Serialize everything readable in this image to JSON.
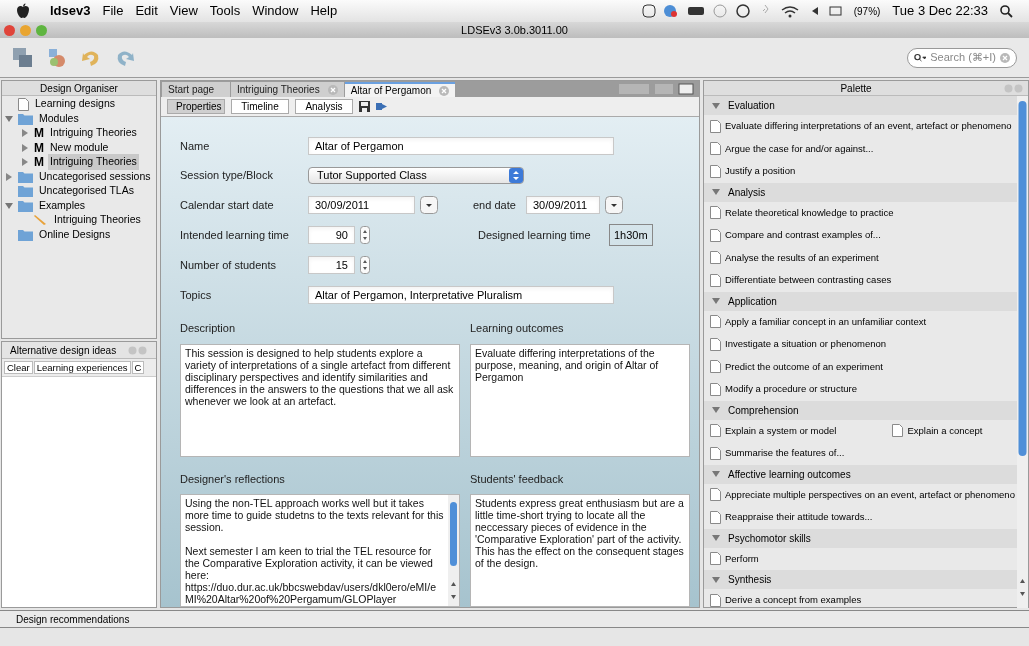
{
  "menu_bar": {
    "app": "ldsev3",
    "items": [
      "File",
      "Edit",
      "View",
      "Tools",
      "Window",
      "Help"
    ],
    "battery": "(97%)",
    "clock": "Tue 3 Dec 22:33"
  },
  "window": {
    "title": "LDSEv3 3.0b.3011.00"
  },
  "search": {
    "placeholder": "Search (⌘+I)"
  },
  "organiser": {
    "title": "Design Organiser",
    "tree": [
      {
        "label": "Learning designs",
        "kind": "file",
        "selected": false
      },
      {
        "label": "Modules",
        "kind": "folder",
        "selected": false,
        "expanded": true,
        "children": [
          {
            "label": "Intriguing Theories",
            "kind": "module",
            "badge": "M",
            "selected": false,
            "expanded": false
          },
          {
            "label": "New module",
            "kind": "module",
            "badge": "M",
            "selected": false,
            "expanded": false
          },
          {
            "label": "Intriguing Theories",
            "kind": "module",
            "badge": "M",
            "selected": true,
            "expanded": false
          }
        ]
      },
      {
        "label": "Uncategorised sessions",
        "kind": "folder",
        "selected": false,
        "expanded": false
      },
      {
        "label": "Uncategorised TLAs",
        "kind": "folder",
        "selected": false
      },
      {
        "label": "Examples",
        "kind": "folder",
        "selected": false,
        "expanded": true,
        "children": [
          {
            "label": "Intriguing Theories",
            "kind": "pencil",
            "selected": false
          }
        ]
      },
      {
        "label": "Online Designs",
        "kind": "folder",
        "selected": false
      }
    ]
  },
  "alternatives": {
    "title": "Alternative design ideas",
    "tabs": [
      "Clear",
      "Learning experiences",
      "C"
    ]
  },
  "doc_tabs": [
    {
      "label": "Start page",
      "selected": false,
      "closable": false
    },
    {
      "label": "Intriguing Theories",
      "selected": false,
      "closable": true
    },
    {
      "label": "Altar of Pergamon",
      "selected": true,
      "closable": true
    }
  ],
  "views": [
    {
      "label": "Properties",
      "selected": true
    },
    {
      "label": "Timeline",
      "selected": false
    },
    {
      "label": "Analysis",
      "selected": false
    }
  ],
  "form": {
    "name": {
      "label": "Name",
      "value": "Altar of Pergamon"
    },
    "session_type": {
      "label": "Session type/Block",
      "value": "Tutor Supported Class"
    },
    "start_date": {
      "label": "Calendar start date",
      "value": "30/09/2011"
    },
    "end_date": {
      "label": "end date",
      "value": "30/09/2011"
    },
    "intended_time": {
      "label": "Intended learning time",
      "value": "90"
    },
    "designed_time": {
      "label": "Designed learning time",
      "value": "1h30m"
    },
    "students": {
      "label": "Number of students",
      "value": "15"
    },
    "topics": {
      "label": "Topics",
      "value": "Altar of Pergamon, Interpretative Pluralism"
    },
    "description": {
      "label": "Description",
      "value": "This session is designed to help students explore a variety of interpretations of a single artefact from different disciplinary perspectives and identify similarities and differences in the answers to the questions that we all ask whenever we look at an artefact."
    },
    "outcomes": {
      "label": "Learning outcomes",
      "value": "Evaluate differing interpretations of the purpose, meaning, and origin of Altar of Pergamon"
    },
    "reflections": {
      "label": "Designer's reflections",
      "value": "Using the non-TEL approach works well but it takes more time to guide studetns to the texts relevant for this session.\n\nNext semester I am keen to trial the TEL resource for the Comparative Exploration activity, it can be viewed here: https://duo.dur.ac.uk/bbcswebdav/users/dkl0ero/eMI/eMI%20Altar%20of%20Pergamum/GLOPlayer"
    },
    "feedback": {
      "label": "Students' feedback",
      "value": "Students express great enthusiasm but are a little time-short trying to locate all the neccessary pieces of evidence in the 'Comparative Exploration' part of the activity. This has the effect on the consequent stages of the design."
    }
  },
  "palette": {
    "title": "Palette",
    "groups": [
      {
        "title": "Evaluation",
        "expanded": true,
        "rows": [
          [
            "Evaluate differing interpretations of an event, artefact or phenomeno"
          ],
          [
            "Argue the case for and/or against..."
          ],
          [
            "Justify a position"
          ]
        ]
      },
      {
        "title": "Analysis",
        "expanded": true,
        "rows": [
          [
            "Relate theoretical knowledge to practice"
          ],
          [
            "Compare and contrast examples of..."
          ],
          [
            "Analyse the results of an experiment"
          ],
          [
            "Differentiate between contrasting cases"
          ]
        ]
      },
      {
        "title": "Application",
        "expanded": true,
        "rows": [
          [
            "Apply a familiar concept in an unfamiliar context"
          ],
          [
            "Investigate a situation or phenomenon"
          ],
          [
            "Predict the outcome of an experiment"
          ],
          [
            "Modify a procedure or structure"
          ]
        ]
      },
      {
        "title": "Comprehension",
        "expanded": true,
        "rows": [
          [
            "Explain a system or model",
            "Explain a concept"
          ],
          [
            "Summarise the features of..."
          ]
        ]
      },
      {
        "title": "Affective learning outcomes",
        "expanded": true,
        "rows": [
          [
            "Appreciate multiple perspectives on an event, artefact or phenomeno"
          ],
          [
            "Reappraise their attitude towards..."
          ]
        ]
      },
      {
        "title": "Psychomotor skills",
        "expanded": true,
        "rows": [
          [
            "Perform"
          ]
        ]
      },
      {
        "title": "Synthesis",
        "expanded": true,
        "rows": [
          [
            "Derive a concept from examples"
          ]
        ]
      }
    ]
  },
  "status_bar": {
    "label": "Design recommendations"
  }
}
